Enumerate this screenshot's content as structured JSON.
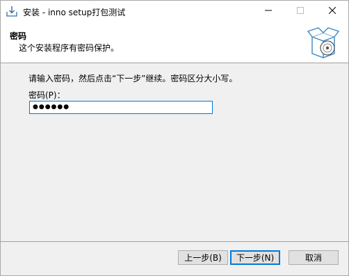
{
  "window": {
    "title": "安装 - inno setup打包测试",
    "icons": {
      "app": "setup-install-icon",
      "minimize": "minimize-icon",
      "maximize": "maximize-icon",
      "close": "close-icon"
    }
  },
  "header": {
    "title": "密码",
    "subtitle": "这个安装程序有密码保护。",
    "image": "setup-box-disc-icon"
  },
  "content": {
    "instruction": "请输入密码，然后点击“下一步”继续。密码区分大小写。",
    "password_label": "密码(P)：",
    "password_value": "●●●●●●"
  },
  "buttons": {
    "back": "上一步(B)",
    "next": "下一步(N)",
    "cancel": "取消"
  }
}
